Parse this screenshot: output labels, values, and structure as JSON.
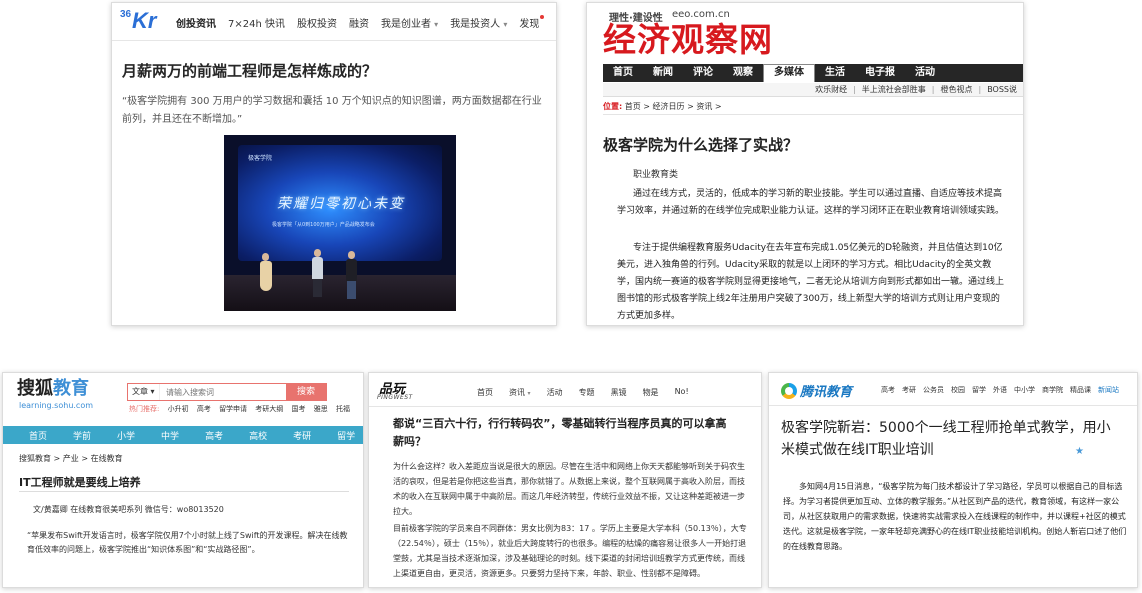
{
  "kr": {
    "logo_num": "36",
    "logo_text": "Kr",
    "nav": [
      "创投资讯",
      "7×24h 快讯",
      "股权投资",
      "融资",
      "我是创业者",
      "我是投资人",
      "发现"
    ],
    "dropdown_glyph": "▾",
    "title": "月薪两万的前端工程师是怎样炼成的？",
    "quote": "“极客学院拥有 300 万用户的学习数据和囊括 10 万个知识点的知识图谱，两方面数据都在行业前列，并且还在不断增加。”",
    "stage_brand": "极客学院",
    "stage_title": "荣耀归零初心未变",
    "stage_sub": "极客学院「从0到100万用户」产品战略发布会"
  },
  "eeo": {
    "slogan": "理性·建设性",
    "domain": "eeo.com.cn",
    "brand": "经济观察网",
    "nav": [
      "首页",
      "新闻",
      "评论",
      "观察",
      "多媒体",
      "生活",
      "电子报",
      "活动"
    ],
    "active_nav": "多媒体",
    "subnav": [
      "欢乐财经",
      "半上流社会部胜事",
      "橙色视点",
      "BOSS说"
    ],
    "subnav_sep": "|",
    "crumb_label": "位置:",
    "crumb_path": "首页 > 经济日历 > 资讯 >",
    "title": "极客学院为什么选择了实战？",
    "category": "职业教育类",
    "paragraphs": [
      "通过在线方式，灵活的，低成本的学习新的职业技能。学生可以通过直播、自适应等技术提高学习效率，并通过新的在线学位完成职业能力认证。这样的学习闭环正在职业教育培训领域实践。",
      "专注于提供编程教育服务Udacity在去年宣布完成1.05亿美元的D轮融资，并且估值达到10亿美元，进入独角兽的行列。Udacity采取的就是以上闭环的学习方式。相比Udacity的全英文教学，国内统一赛道的极客学院则显得更接地气，二者无论从培训方向到形式都如出一辙。通过线上图书馆的形式极客学院上线2年注册用户突破了300万，线上新型大学的培训方式则让用户变现的方式更加多样。"
    ]
  },
  "sohu": {
    "brand_main": "搜狐",
    "brand_edu": "教育",
    "domain": "learning.sohu.com",
    "search_select": "文章",
    "search_select_arrow": "▾",
    "search_placeholder": "请输入搜索词",
    "search_button": "搜索",
    "hot_label": "热门推荐:",
    "hot_items": [
      "小升初",
      "高考",
      "留学申请",
      "考研大纲",
      "国考",
      "雅思",
      "托福"
    ],
    "nav": [
      "首页",
      "学前",
      "小学",
      "中学",
      "高考",
      "高校",
      "考研",
      "留学"
    ],
    "crumb": "搜狐教育 > 产业 > 在线教育",
    "title": "IT工程师就是要线上培养",
    "author": "文/黄嘉卿 在线教育很美吧系列 微信号：wo8013520",
    "body": "“苹果发布Swift开发语言时，极客学院仅用7个小时就上线了Swift的开发课程。解决在线教育低效率的问题上，极客学院推出“知识体系图”和“实战路径图”。"
  },
  "pingwest": {
    "logo": "品玩",
    "sublogo": "PINGWEST",
    "nav": [
      "首页",
      "资讯",
      "活动",
      "专题",
      "黑镜",
      "物是",
      "No!"
    ],
    "nav_dropdown_index": 1,
    "dropdown_glyph": "▾",
    "title": "都说“三百六十行，行行转码农”，零基础转行当程序员真的可以拿高薪吗？",
    "paragraphs": [
      "为什么会这样？收入差距应当说是很大的原因。尽管在生活中和网络上你天天都能够听到关于码农生活的哀叹，但是若是你把这些当真，那你就错了。从数据上来说，整个互联网属于高收入阶层，而技术的收入在互联网中属于中高阶层。而这几年经济转型，传统行业效益不振，又让这种差距被进一步拉大。",
      "目前极客学院的学员来自不同群体：男女比例为83：17 。学历上主要是大学本科（50.13％），大专（22.54％），硕士（15％），就业后大跨度转行的也很多。编程的枯燥的痛容易让很多人一开始打退堂鼓，尤其是当技术逐渐加深，涉及基础理论的时刻。线下渠道的封闭培训班教学方式更传统，而线上渠道更自由，更灵活，资源更多。只要努力坚持下来，年龄、职业、性别都不是障碍。"
    ]
  },
  "qq": {
    "logo": "腾讯教育",
    "nav": [
      "高考",
      "考研",
      "公务员",
      "校园",
      "留学",
      "外语",
      "中小学",
      "商学院",
      "精品课",
      "新闻站"
    ],
    "title": "极客学院靳岩：5000个一线工程师抢单式教学，用小米模式做在线IT职业培训",
    "star": "★",
    "body": "多知网4月15日消息，“极客学院为每门技术都设计了学习路径，学员可以根据自己的目标选择。为学习者提供更加互动、立体的教学服务。”从社区到产品的迭代，教育领域，有这样一家公司，从社区获取用户的需求数据，快速将实战需求投入在线课程的制作中，并以课程+社区的模式迭代。这就是极客学院，一家年轻却充满野心的在线IT职业技能培训机构。创始人靳岩口述了他们的在线教育思路。"
  }
}
